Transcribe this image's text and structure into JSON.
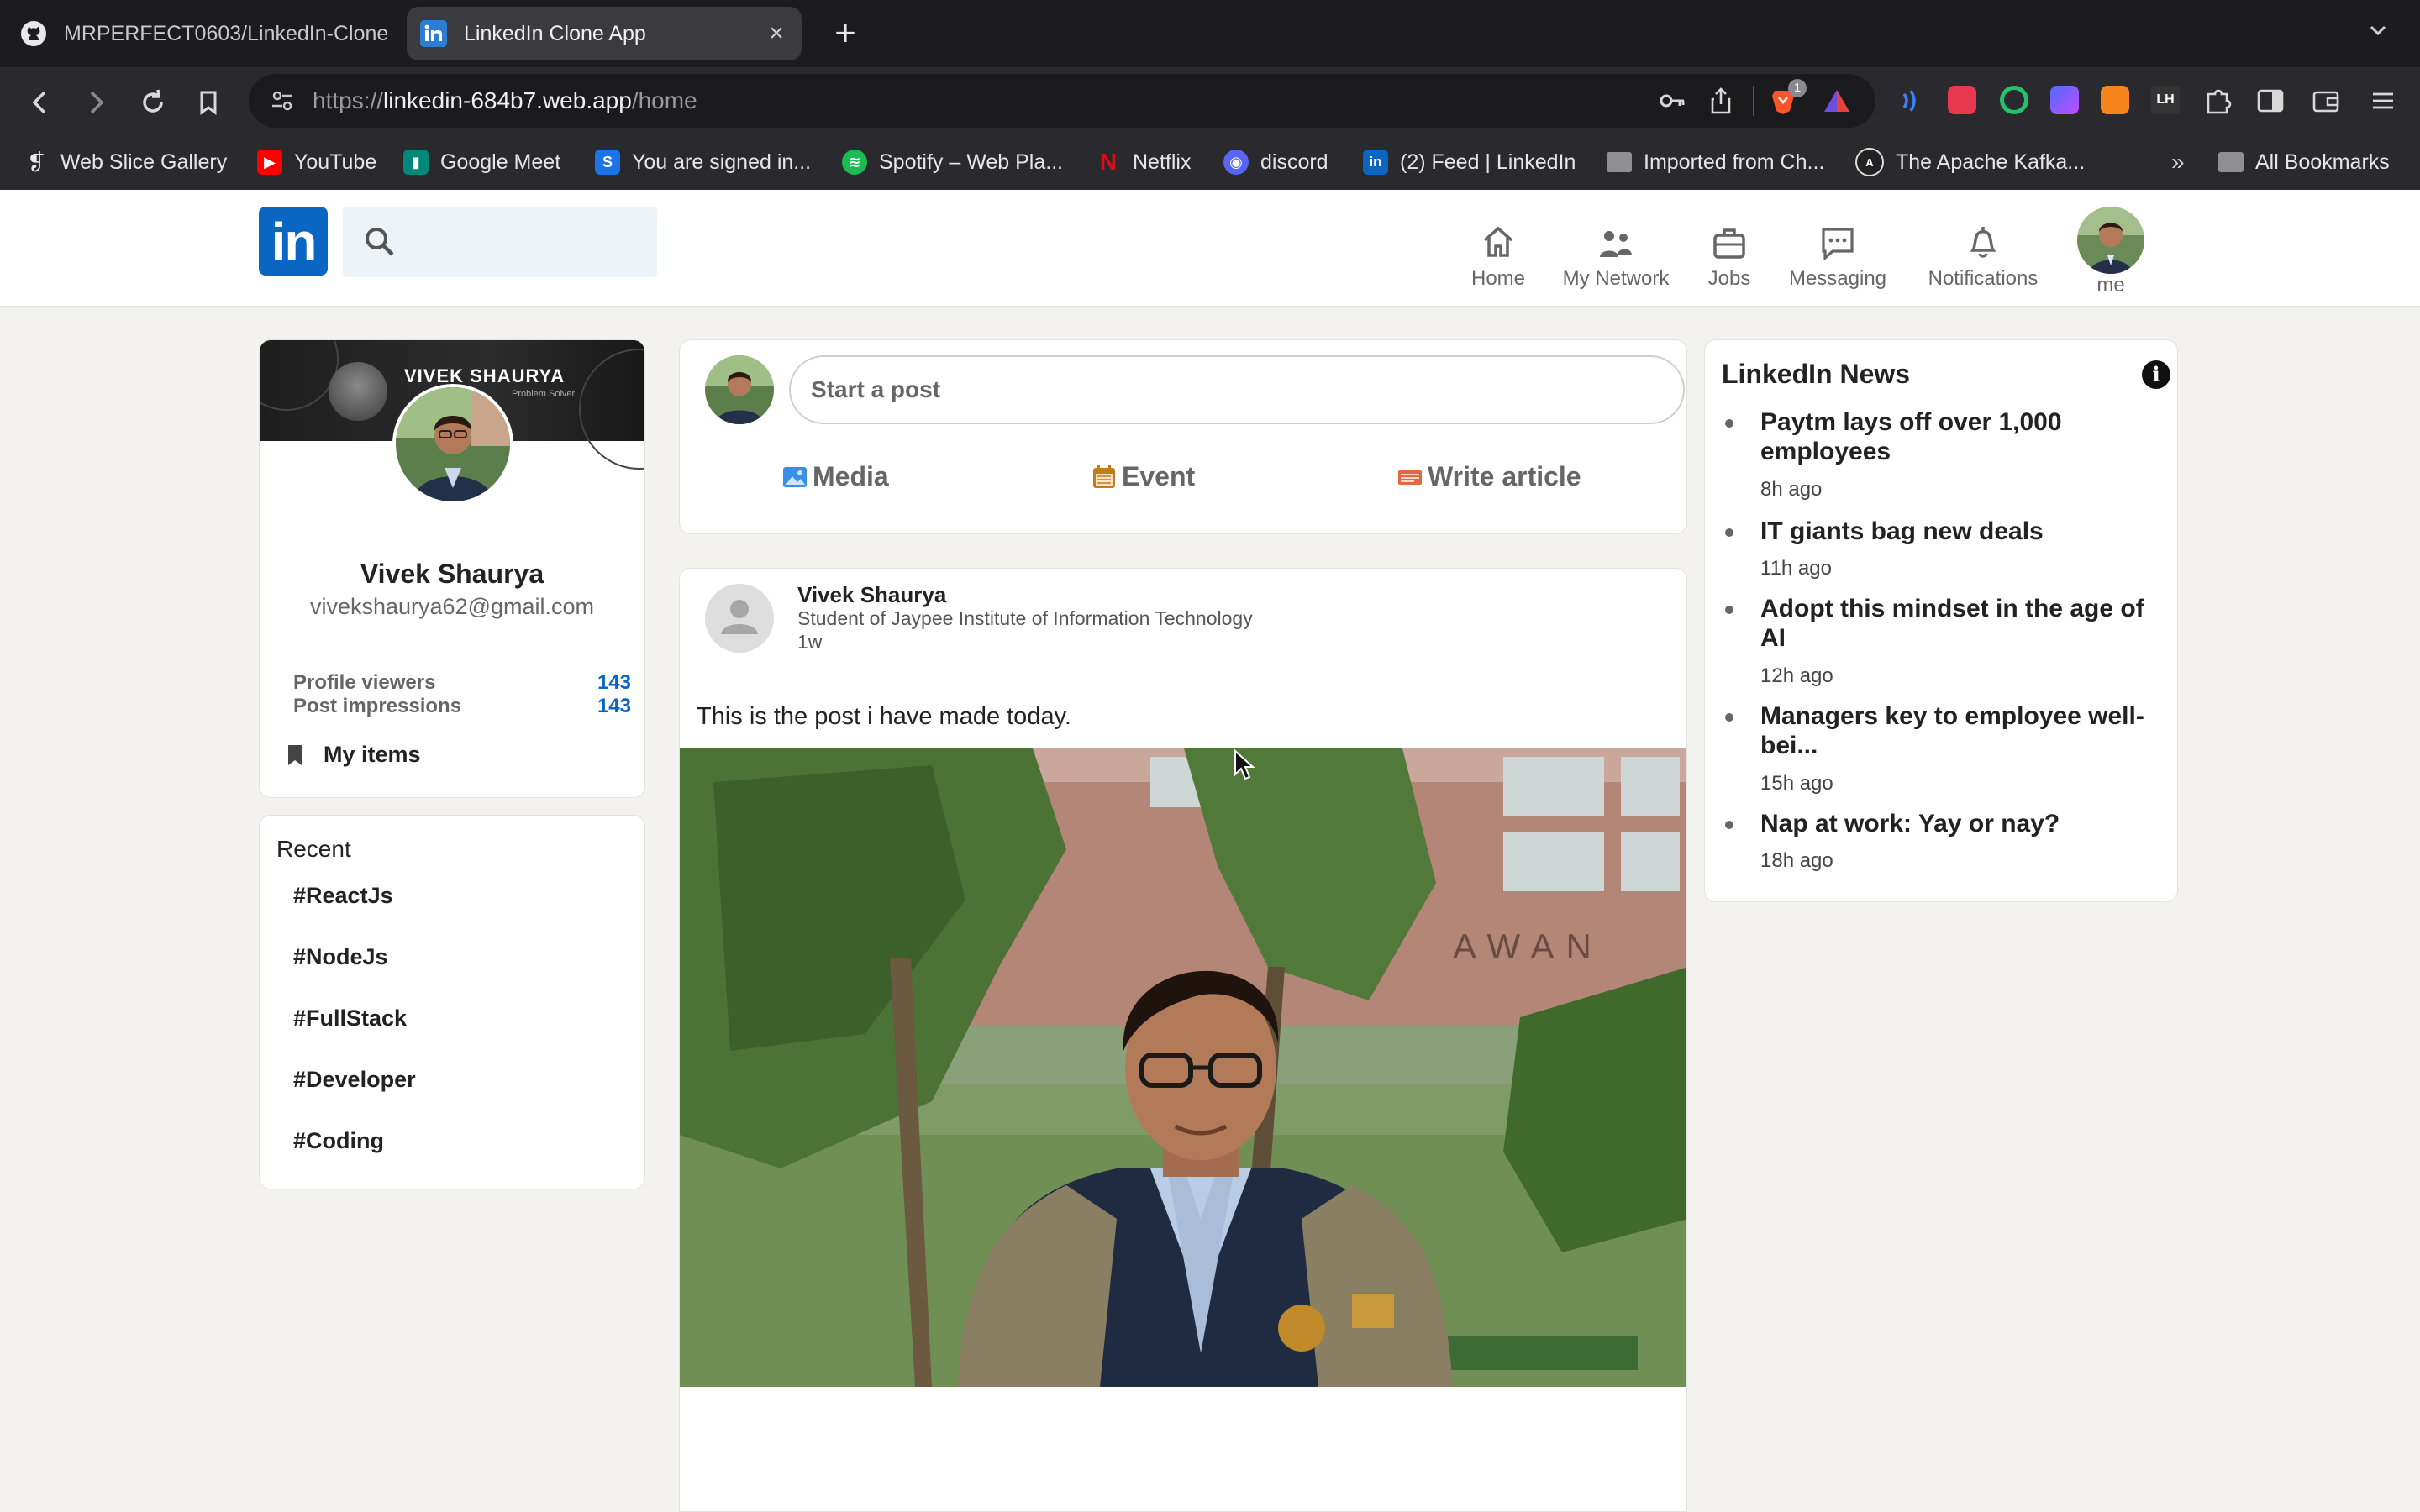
{
  "browser": {
    "tabs": [
      {
        "title": "MRPERFECT0603/LinkedIn-Clone",
        "active": false,
        "icon": "github-icon"
      },
      {
        "title": "LinkedIn Clone App",
        "active": true,
        "icon": "linkedin-icon"
      }
    ],
    "url": {
      "scheme": "https://",
      "host": "linkedin-684b7.web.app",
      "path": "/home"
    },
    "extension_badge": "1",
    "bookmarks": [
      {
        "label": "Web Slice Gallery",
        "icon": "web-slice-icon",
        "color": "#e8e8e8"
      },
      {
        "label": "YouTube",
        "icon": "youtube-icon",
        "color": "#ff0000"
      },
      {
        "label": "Google Meet",
        "icon": "google-meet-icon",
        "color": "#00897b"
      },
      {
        "label": "You are signed in...",
        "icon": "s-icon",
        "color": "#1a73e8"
      },
      {
        "label": "Spotify – Web Pla...",
        "icon": "spotify-icon",
        "color": "#1db954"
      },
      {
        "label": "Netflix",
        "icon": "netflix-icon",
        "color": "#e50914"
      },
      {
        "label": "discord",
        "icon": "discord-icon",
        "color": "#5865f2"
      },
      {
        "label": "(2) Feed | LinkedIn",
        "icon": "linkedin-icon",
        "color": "#0a66c2"
      },
      {
        "label": "Imported from Ch...",
        "icon": "folder-icon",
        "color": "#9a9a9a"
      },
      {
        "label": "The Apache Kafka...",
        "icon": "kafka-icon",
        "color": "#222222"
      }
    ],
    "bookmarks_overflow": "»",
    "all_bookmarks": "All Bookmarks"
  },
  "header": {
    "logo_text": "in",
    "search_placeholder": "",
    "nav": [
      {
        "label": "Home",
        "icon": "home-icon"
      },
      {
        "label": "My Network",
        "icon": "network-icon"
      },
      {
        "label": "Jobs",
        "icon": "briefcase-icon"
      },
      {
        "label": "Messaging",
        "icon": "messaging-icon"
      },
      {
        "label": "Notifications",
        "icon": "bell-icon"
      }
    ],
    "me_label": "me"
  },
  "profile": {
    "banner_name": "VIVEK SHAURYA",
    "banner_sub": "Problem Solver",
    "name": "Vivek Shaurya",
    "email": "vivekshaurya62@gmail.com",
    "stats": [
      {
        "label": "Profile viewers",
        "value": "143"
      },
      {
        "label": "Post impressions",
        "value": "143"
      }
    ],
    "my_items": "My items"
  },
  "recent": {
    "title": "Recent",
    "tags": [
      "ReactJs",
      "NodeJs",
      "FullStack",
      "Developer",
      "Coding"
    ],
    "hash": "#"
  },
  "composer": {
    "placeholder": "Start a post",
    "actions": [
      {
        "label": "Media",
        "icon": "photo-icon",
        "color": "#378fe9"
      },
      {
        "label": "Event",
        "icon": "calendar-icon",
        "color": "#c37d16"
      },
      {
        "label": "Write article",
        "icon": "article-icon",
        "color": "#e06847"
      }
    ]
  },
  "post": {
    "author": "Vivek Shaurya",
    "description": "Student of Jaypee Institute of Information Technology",
    "time": "1w",
    "text": "This is the post i have made today."
  },
  "news": {
    "title": "LinkedIn News",
    "info_icon": "i",
    "items": [
      {
        "headline": "Paytm lays off over 1,000 employees",
        "time": "8h ago"
      },
      {
        "headline": "IT giants bag new deals",
        "time": "11h ago"
      },
      {
        "headline": "Adopt this mindset in the age of AI",
        "time": "12h ago"
      },
      {
        "headline": "Managers key to employee well-bei...",
        "time": "15h ago"
      },
      {
        "headline": "Nap at work: Yay or nay?",
        "time": "18h ago"
      }
    ]
  },
  "colors": {
    "brand": "#0a66c2",
    "page_bg": "#f4f2ee",
    "chrome_bg": "#2a2a2e"
  }
}
